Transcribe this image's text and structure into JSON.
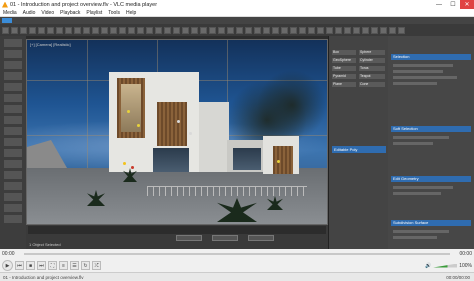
{
  "window": {
    "title": "01 - Introduction and project overview.flv - VLC media player",
    "minimize": "—",
    "maximize": "☐",
    "close": "✕"
  },
  "menu": [
    "Media",
    "Audio",
    "Video",
    "Playback",
    "Playlist",
    "Tools",
    "Help"
  ],
  "video": {
    "viewport_label": "[+] [Camera] [Realistic]",
    "selection_status": "1 Object Selected",
    "cmd_panel": {
      "rows": [
        "Box",
        "Sphere",
        "GeoSphere",
        "Cylinder",
        "Tube",
        "Torus",
        "Pyramid",
        "Teapot",
        "Plane",
        "Cone"
      ],
      "editable": "Editable Poly"
    },
    "props_headers": [
      "Selection",
      "Soft Selection",
      "Edit Geometry",
      "Subdivision Surface"
    ]
  },
  "player": {
    "elapsed": "00:00",
    "duration": "00:00",
    "progress": 0.0,
    "volume": "100%",
    "status_text": "01 - Introduction and project overview.flv",
    "status_right": "00:00/00:00"
  }
}
